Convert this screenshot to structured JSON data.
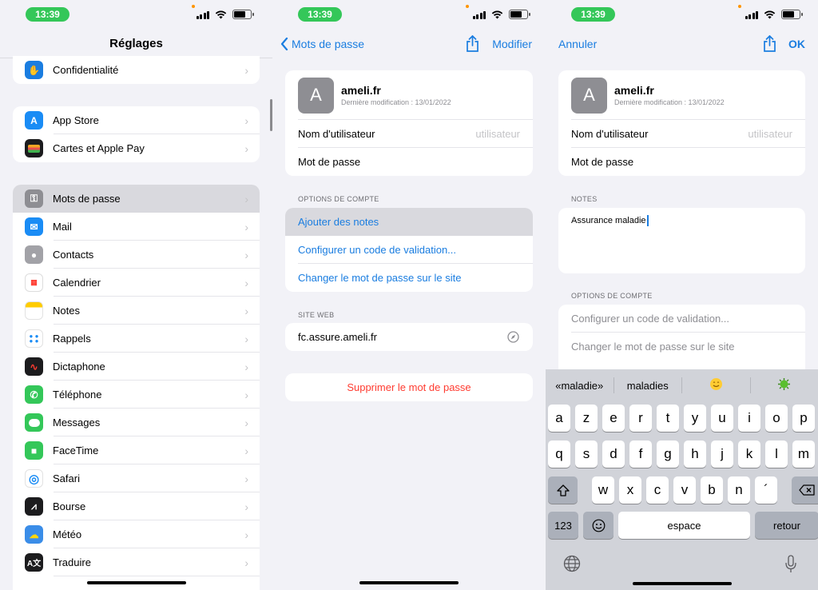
{
  "status": {
    "time": "13:39"
  },
  "s1": {
    "title": "Réglages",
    "items": [
      {
        "label": "Confidentialité",
        "icon": "hand-icon",
        "color": "#1a7de0"
      },
      {
        "label": "App Store",
        "icon": "app-store-icon",
        "color": "#1a8cf5"
      },
      {
        "label": "Cartes et Apple Pay",
        "icon": "wallet-icon",
        "color": "#1c1c1e"
      },
      {
        "label": "Mots de passe",
        "icon": "key-icon",
        "color": "#8e8e93"
      },
      {
        "label": "Mail",
        "icon": "mail-icon",
        "color": "#1a8cf5"
      },
      {
        "label": "Contacts",
        "icon": "contacts-icon",
        "color": "#a2a2a7"
      },
      {
        "label": "Calendrier",
        "icon": "calendar-icon",
        "color": "#ffffff"
      },
      {
        "label": "Notes",
        "icon": "notes-icon",
        "color": "#ffcc00"
      },
      {
        "label": "Rappels",
        "icon": "reminders-icon",
        "color": "#ffffff"
      },
      {
        "label": "Dictaphone",
        "icon": "voice-memos-icon",
        "color": "#1c1c1e"
      },
      {
        "label": "Téléphone",
        "icon": "phone-icon",
        "color": "#34c759"
      },
      {
        "label": "Messages",
        "icon": "messages-icon",
        "color": "#34c759"
      },
      {
        "label": "FaceTime",
        "icon": "facetime-icon",
        "color": "#34c759"
      },
      {
        "label": "Safari",
        "icon": "safari-icon",
        "color": "#1a8cf5"
      },
      {
        "label": "Bourse",
        "icon": "stocks-icon",
        "color": "#1c1c1e"
      },
      {
        "label": "Météo",
        "icon": "weather-icon",
        "color": "#3a8de8"
      },
      {
        "label": "Traduire",
        "icon": "translate-icon",
        "color": "#1c1c1e"
      }
    ]
  },
  "s2": {
    "back": "Mots de passe",
    "edit": "Modifier",
    "avatar": "A",
    "site": "ameli.fr",
    "modified": "Dernière modification : 13/01/2022",
    "user_label": "Nom d'utilisateur",
    "user_placeholder": "utilisateur",
    "pass_label": "Mot de passe",
    "options_header": "OPTIONS DE COMPTE",
    "add_notes": "Ajouter des notes",
    "config_code": "Configurer un code de validation...",
    "change_pass": "Changer le mot de passe sur le site",
    "site_header": "SITE WEB",
    "website": "fc.assure.ameli.fr",
    "delete": "Supprimer le mot de passe"
  },
  "s3": {
    "cancel": "Annuler",
    "ok": "OK",
    "avatar": "A",
    "site": "ameli.fr",
    "modified": "Dernière modification : 13/01/2022",
    "user_label": "Nom d'utilisateur",
    "user_placeholder": "utilisateur",
    "pass_label": "Mot de passe",
    "notes_header": "NOTES",
    "notes_text": "Assurance maladie",
    "options_header": "OPTIONS DE COMPTE",
    "config_code": "Configurer un code de validation...",
    "change_pass": "Changer le mot de passe sur le site"
  },
  "keyboard": {
    "suggestions": [
      "«maladie»",
      "maladies"
    ],
    "row1": [
      "a",
      "z",
      "e",
      "r",
      "t",
      "y",
      "u",
      "i",
      "o",
      "p"
    ],
    "row2": [
      "q",
      "s",
      "d",
      "f",
      "g",
      "h",
      "j",
      "k",
      "l",
      "m"
    ],
    "row3": [
      "w",
      "x",
      "c",
      "v",
      "b",
      "n",
      "´"
    ],
    "numbers": "123",
    "space": "espace",
    "return": "retour"
  }
}
